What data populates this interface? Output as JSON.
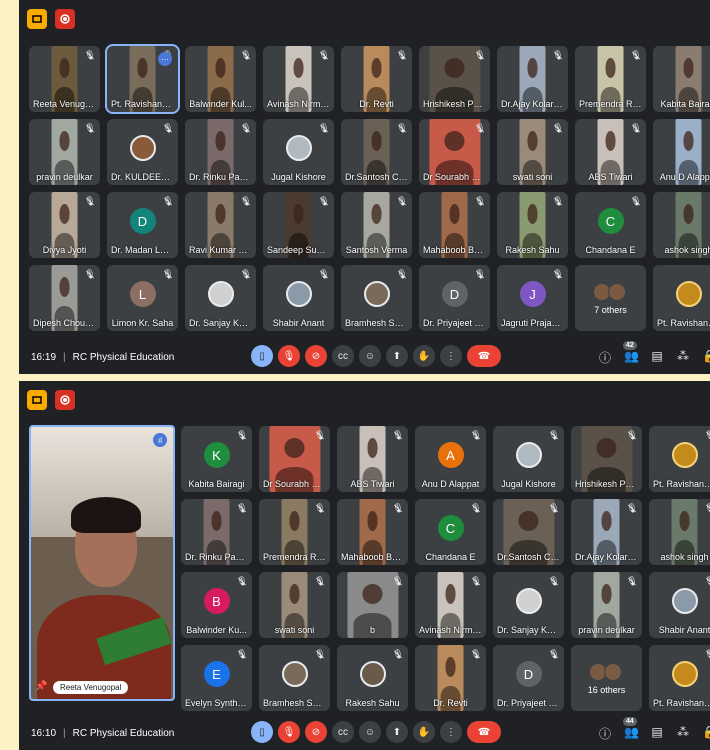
{
  "screens": [
    {
      "time": "16:19",
      "meeting": "RC Physical Education",
      "participant_count": "42",
      "tiles": [
        {
          "name": "Reeta Venugo...",
          "kind": "photo",
          "color": "#6c5a3c"
        },
        {
          "name": "Pt. Ravishanka...",
          "kind": "photo",
          "color": "#7a6c5a",
          "active": true
        },
        {
          "name": "Balwinder Kul...",
          "kind": "photo",
          "color": "#8a6c4a"
        },
        {
          "name": "Avinash Nirmal...",
          "kind": "photo",
          "color": "#c9c3bb"
        },
        {
          "name": "Dr. Revti",
          "kind": "photo",
          "color": "#b88a5c"
        },
        {
          "name": "Hrishikesh Patel",
          "kind": "photo",
          "color": "#5a5248",
          "wide": true
        },
        {
          "name": "Dr.Ajay Kolarkar",
          "kind": "photo",
          "color": "#9aa8b8"
        },
        {
          "name": "Premendra Ra...",
          "kind": "photo",
          "color": "#c8c4a8"
        },
        {
          "name": "Kabita Bairagi",
          "kind": "photo",
          "color": "#8a7c70"
        },
        {
          "name": "pravin deulkar",
          "kind": "photo",
          "color": "#a0a8a0"
        },
        {
          "name": "Dr. KULDEEP D...",
          "kind": "pic",
          "color": "#8a5a3a"
        },
        {
          "name": "Dr. Rinku Pand...",
          "kind": "photo",
          "color": "#7a6a6a"
        },
        {
          "name": "Jugal Kishore",
          "kind": "pic",
          "color": "#b0b8c0"
        },
        {
          "name": "Dr.Santosh Ch...",
          "kind": "photo",
          "color": "#6a6056"
        },
        {
          "name": "Dr Sourabh Pr...",
          "kind": "photo",
          "color": "#c85a4a",
          "wide": true
        },
        {
          "name": "swati soni",
          "kind": "photo",
          "color": "#9a8a7a"
        },
        {
          "name": "ABS Tiwari",
          "kind": "photo",
          "color": "#c8c0b8"
        },
        {
          "name": "Anu D Alappat",
          "kind": "photo",
          "color": "#9ab0c8"
        },
        {
          "name": "Divya Jyoti",
          "kind": "photo",
          "color": "#b8a898"
        },
        {
          "name": "Dr. Madan Lal ...",
          "kind": "avatar",
          "letter": "D",
          "color": "#12857a"
        },
        {
          "name": "Ravi Kumar Tri...",
          "kind": "photo",
          "color": "#8a7a6a"
        },
        {
          "name": "Sandeep Sunny",
          "kind": "photo",
          "color": "#4a3a30"
        },
        {
          "name": "Santosh Verma",
          "kind": "photo",
          "color": "#a8a8a0"
        },
        {
          "name": "Mahaboob Bas...",
          "kind": "photo",
          "color": "#a06a4a"
        },
        {
          "name": "Rakesh Sahu",
          "kind": "photo",
          "color": "#8a9a70"
        },
        {
          "name": "Chandana E",
          "kind": "avatar",
          "letter": "C",
          "color": "#1e8e3e"
        },
        {
          "name": "ashok singh",
          "kind": "photo",
          "color": "#6a7a6a"
        },
        {
          "name": "Dipesh Choud...",
          "kind": "photo",
          "color": "#9a9a96"
        },
        {
          "name": "Limon Kr. Saha",
          "kind": "avatar",
          "letter": "L",
          "color": "#8d6e63"
        },
        {
          "name": "Dr. Sanjay Kum...",
          "kind": "pic",
          "color": "#d0d0d0"
        },
        {
          "name": "Shabir Anant",
          "kind": "pic",
          "color": "#8a9aa8"
        },
        {
          "name": "Bramhesh Shri...",
          "kind": "pic",
          "color": "#7a6a5a"
        },
        {
          "name": "Dr. Priyajeet M...",
          "kind": "avatar",
          "letter": "D",
          "color": "#5f6368"
        },
        {
          "name": "Jagruti Prajap...",
          "kind": "avatar",
          "letter": "J",
          "color": "#7e57c2"
        },
        {
          "name": "7 others",
          "kind": "others"
        },
        {
          "name": "Pt. Ravishanka...",
          "kind": "logo",
          "color": "#c58a1c"
        }
      ]
    },
    {
      "time": "16:10",
      "meeting": "RC Physical Education",
      "participant_count": "44",
      "featured_name": "Reeta Venugopal",
      "tiles": [
        {
          "name": "Kabita Bairagi",
          "kind": "avatar",
          "letter": "K",
          "color": "#1e8e3e"
        },
        {
          "name": "Dr Sourabh Pr...",
          "kind": "photo",
          "color": "#c85a4a",
          "wide": true
        },
        {
          "name": "ABS Tiwari",
          "kind": "photo",
          "color": "#c8c0b8"
        },
        {
          "name": "Anu D Alappat",
          "kind": "avatar",
          "letter": "A",
          "color": "#e8710a"
        },
        {
          "name": "Jugal Kishore",
          "kind": "pic",
          "color": "#b0b8c0"
        },
        {
          "name": "Hrishikesh Patel",
          "kind": "photo",
          "color": "#5a5248",
          "wide": true
        },
        {
          "name": "Pt. Ravishanka...",
          "kind": "logo",
          "color": "#c58a1c"
        },
        {
          "name": "Dr. Rinku Pand...",
          "kind": "photo",
          "color": "#7a6a6a"
        },
        {
          "name": "Premendra Ra...",
          "kind": "photo",
          "color": "#8a7a60"
        },
        {
          "name": "Mahaboob Bas...",
          "kind": "photo",
          "color": "#a06a4a"
        },
        {
          "name": "Chandana E",
          "kind": "avatar",
          "letter": "C",
          "color": "#1e8e3e"
        },
        {
          "name": "Dr.Santosh Ch...",
          "kind": "photo",
          "color": "#6a6056",
          "wide": true
        },
        {
          "name": "Dr.Ajay Kolarkar",
          "kind": "photo",
          "color": "#9aa8b8"
        },
        {
          "name": "ashok singh",
          "kind": "photo",
          "color": "#6a7a6a"
        },
        {
          "name": "Balwinder Ku...",
          "kind": "avatar",
          "letter": "B",
          "color": "#d81b60"
        },
        {
          "name": "swati soni",
          "kind": "photo",
          "color": "#9a8a7a"
        },
        {
          "name": "b",
          "kind": "photo",
          "color": "#8a8a8a",
          "wide": true
        },
        {
          "name": "Avinash Nirmal...",
          "kind": "photo",
          "color": "#c9c3bb"
        },
        {
          "name": "Dr. Sanjay Kum...",
          "kind": "pic",
          "color": "#d0d0d0"
        },
        {
          "name": "pravin deulkar",
          "kind": "photo",
          "color": "#a0a8a0"
        },
        {
          "name": "Shabir Anant",
          "kind": "pic",
          "color": "#8a9aa8"
        },
        {
          "name": "Evelyn Synthiya",
          "kind": "avatar",
          "letter": "E",
          "color": "#1a73e8"
        },
        {
          "name": "Bramhesh Shri...",
          "kind": "pic",
          "color": "#7a6a5a"
        },
        {
          "name": "Rakesh Sahu",
          "kind": "pic",
          "color": "#6a5a4a"
        },
        {
          "name": "Dr. Revti",
          "kind": "photo",
          "color": "#b88a5c"
        },
        {
          "name": "Dr. Priyajeet M...",
          "kind": "avatar",
          "letter": "D",
          "color": "#5f6368"
        },
        {
          "name": "16 others",
          "kind": "others"
        },
        {
          "name": "Pt. Ravishanka...",
          "kind": "logo",
          "color": "#c58a1c"
        }
      ]
    }
  ],
  "colors": {
    "background": "#fdf2c4",
    "meet_bg": "#202124",
    "tile_bg": "#3c4043",
    "end_call": "#ea4335",
    "accent": "#8ab4f8"
  }
}
